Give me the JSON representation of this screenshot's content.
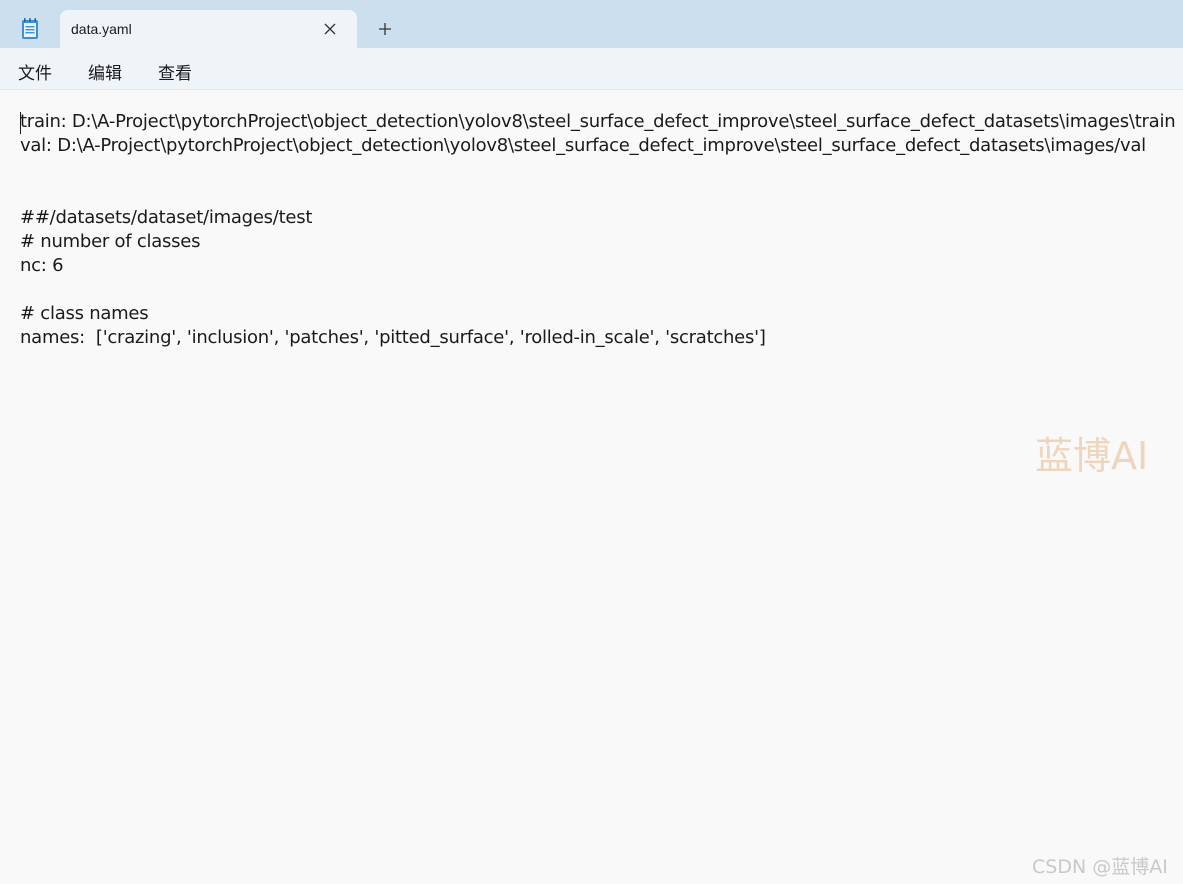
{
  "window": {
    "app_icon": "notepad-icon",
    "tabs": [
      {
        "title": "data.yaml",
        "close_icon": "close-icon"
      }
    ],
    "new_tab_icon": "plus-icon"
  },
  "menu": {
    "items": [
      "文件",
      "编辑",
      "查看"
    ]
  },
  "editor": {
    "lines": [
      "train: D:\\A-Project\\pytorchProject\\object_detection\\yolov8\\steel_surface_defect_improve\\steel_surface_defect_datasets\\images\\train",
      "val: D:\\A-Project\\pytorchProject\\object_detection\\yolov8\\steel_surface_defect_improve\\steel_surface_defect_datasets\\images/val",
      "",
      "",
      "##/datasets/dataset/images/test",
      "# number of classes",
      "nc: 6",
      "",
      "# class names",
      "names:  ['crazing', 'inclusion', 'patches', 'pitted_surface', 'rolled-in_scale', 'scratches']"
    ]
  },
  "overlay": {
    "watermark": "蓝博AI",
    "credit": "CSDN @蓝博AI"
  },
  "colors": {
    "tabstrip": "#ccdfee",
    "active_tab": "#eff4f9",
    "editor_bg": "#f9f9f9",
    "text": "#1a1a1a",
    "watermark": "#f0d5bd"
  }
}
